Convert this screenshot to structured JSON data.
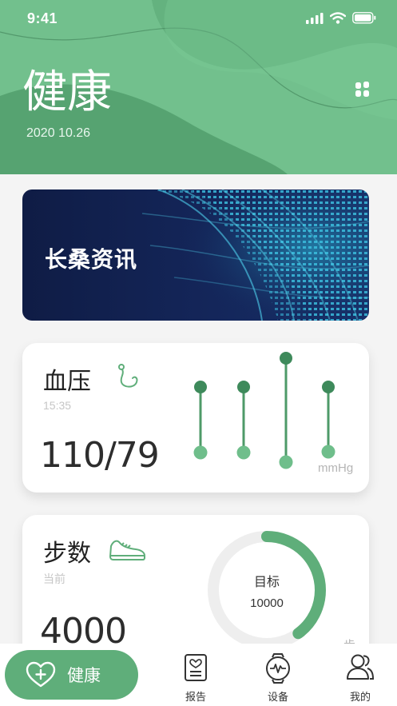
{
  "status_bar": {
    "time": "9:41"
  },
  "header": {
    "title": "健康",
    "date": "2020 10.26"
  },
  "banner": {
    "title": "长桑资讯"
  },
  "blood_pressure": {
    "title": "血压",
    "time": "15:35",
    "value": "110/79",
    "unit": "mmHg"
  },
  "steps": {
    "title": "步数",
    "sub": "当前",
    "value": "4000",
    "goal_label": "目标",
    "goal_value": "10000",
    "unit_partial": "步",
    "progress": 0.4
  },
  "tabbar": {
    "health": "健康",
    "report": "报告",
    "device": "设备",
    "mine": "我的"
  },
  "colors": {
    "accent": "#5fae7a",
    "accent_dark": "#3e8a5b",
    "header": "#6fbe8b"
  }
}
